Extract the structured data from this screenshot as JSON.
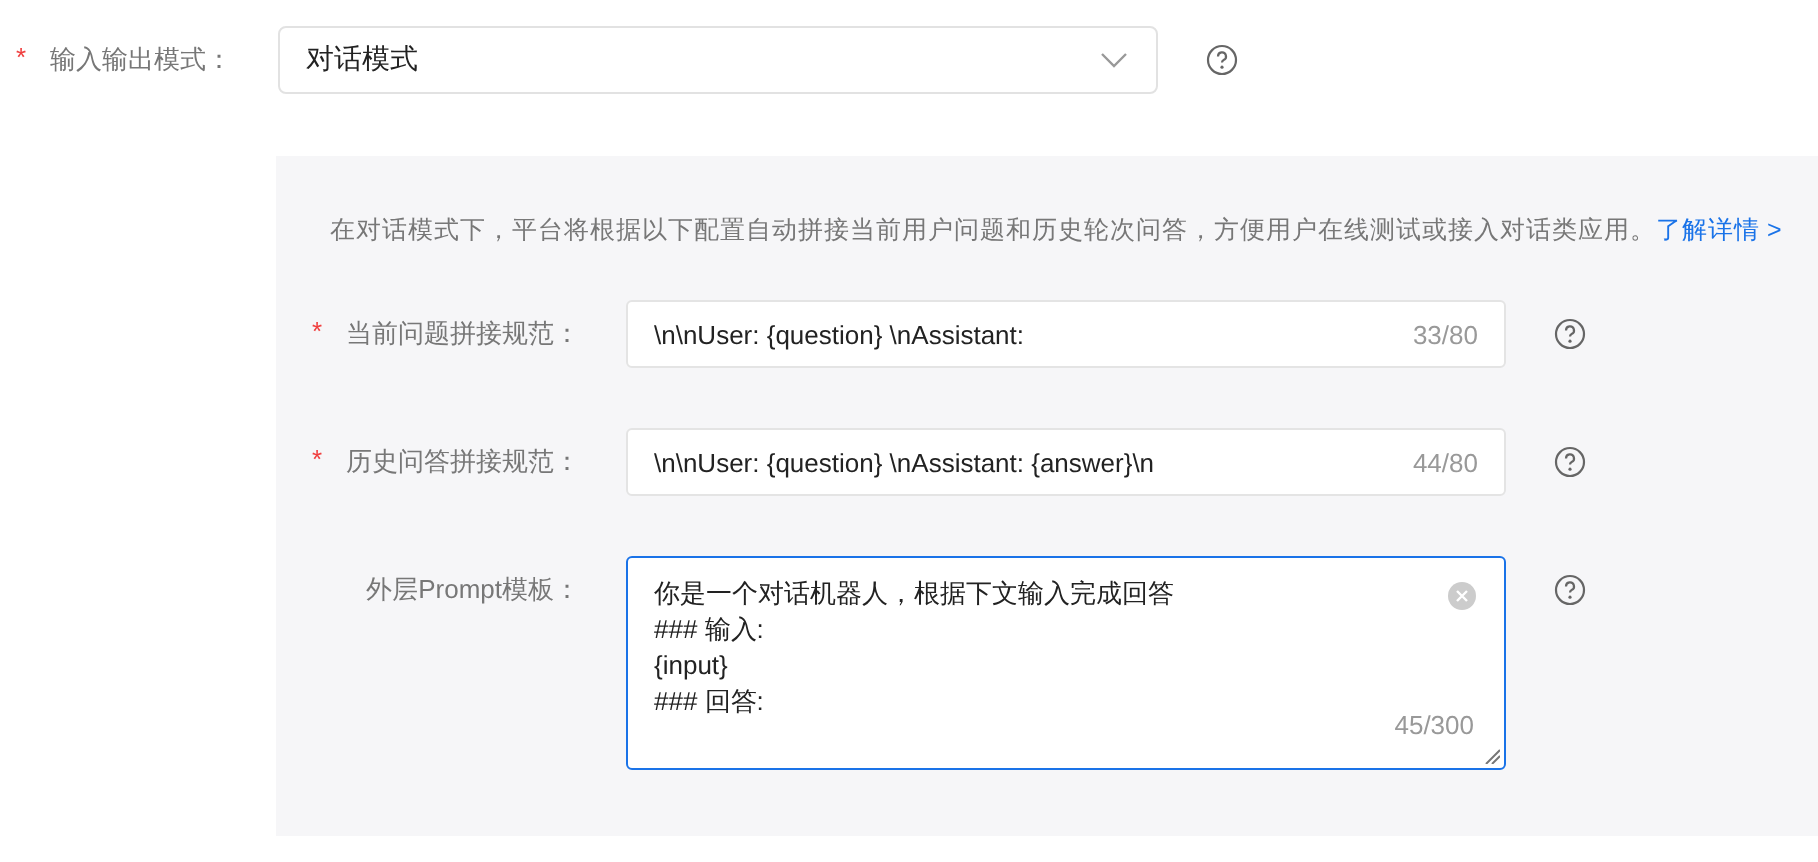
{
  "required_mark": "*",
  "mode": {
    "label": "输入输出模式：",
    "required": true,
    "value": "对话模式"
  },
  "panel": {
    "intro": "在对话模式下，平台将根据以下配置自动拼接当前用户问题和历史轮次问答，方便用户在线测试或接入对话类应用。",
    "link": "了解详情 >",
    "fields": [
      {
        "kind": "input",
        "label": "当前问题拼接规范：",
        "required": true,
        "value": "\\n\\nUser: {question} \\nAssistant:",
        "count": "33/80",
        "focused": false
      },
      {
        "kind": "input",
        "label": "历史问答拼接规范：",
        "required": true,
        "value": "\\n\\nUser: {question} \\nAssistant: {answer}\\n",
        "count": "44/80",
        "focused": false
      },
      {
        "kind": "textarea",
        "label": "外层Prompt模板：",
        "required": false,
        "value": "你是一个对话机器人，根据下文输入完成回答\n### 输入:\n{input}\n### 回答:",
        "count": "45/300",
        "focused": true
      }
    ]
  }
}
